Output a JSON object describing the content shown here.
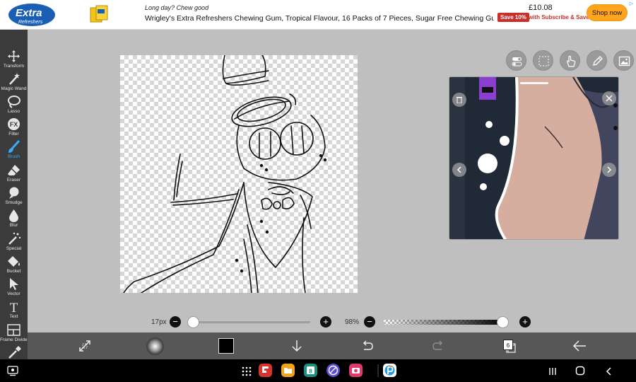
{
  "ad": {
    "brand_logo_text": "Extra Refreshers",
    "tagline": "Long day? Chew good",
    "title": "Wrigley's Extra Refreshers Chewing Gum, Tropical Flavour, 16 Packs of 7 Pieces, Sugar Free Chewing Gum Bulk Pa...",
    "price": "£10.08",
    "save_badge": "Save 10%",
    "subscribe_text": "with Subscribe & Save",
    "cta": "Shop now",
    "info_icon": "info-icon"
  },
  "sidebar": {
    "tools": [
      {
        "label": "Transform",
        "icon": "move-icon"
      },
      {
        "label": "Magic Wand",
        "icon": "magic-wand-icon"
      },
      {
        "label": "Lasso",
        "icon": "lasso-icon"
      },
      {
        "label": "Filter",
        "icon": "fx-icon",
        "icon_text": "FX"
      },
      {
        "label": "Brush",
        "icon": "brush-icon",
        "active": true
      },
      {
        "label": "Eraser",
        "icon": "eraser-icon"
      },
      {
        "label": "Smudge",
        "icon": "smudge-icon"
      },
      {
        "label": "Blur",
        "icon": "drop-icon"
      },
      {
        "label": "Special",
        "icon": "sparkle-wand-icon"
      },
      {
        "label": "Bucket",
        "icon": "bucket-icon"
      },
      {
        "label": "Vector",
        "icon": "cursor-icon"
      },
      {
        "label": "Text",
        "icon": "text-icon",
        "icon_text": "T"
      },
      {
        "label": "Frame Divider",
        "icon": "frame-divider-icon"
      },
      {
        "label": "",
        "icon": "eyedropper-icon"
      }
    ]
  },
  "mode_buttons": [
    "toggle-icon",
    "selection-icon",
    "hand-edit-icon",
    "pen-icon",
    "reference-image-icon"
  ],
  "controls": {
    "brush_size": "17px",
    "brush_size_fraction": 0.0,
    "opacity": "98%",
    "opacity_fraction": 0.98,
    "minus": "−",
    "plus": "+"
  },
  "actionbar": {
    "layers_count": "6",
    "icons": [
      "transform-quick-icon",
      "brush-preview",
      "color-swatch",
      "download-icon",
      "undo-icon",
      "redo-icon",
      "layers-icon",
      "back-arrow-icon"
    ]
  },
  "colors": {
    "accent": "#3fa9f5",
    "sidebar_bg": "#3b3b3b",
    "workspace_bg": "#bfbfbf",
    "actionbar_bg": "#575757",
    "primary_color": "#000000"
  },
  "navbar": {
    "apps": [
      {
        "name": "app-drawer-icon",
        "color": "#000000"
      },
      {
        "name": "flipboard-icon",
        "color": "#d8332c"
      },
      {
        "name": "folder-icon",
        "color": "#f2a31b"
      },
      {
        "name": "calendar-icon",
        "color": "#1d8f7e",
        "text": "8"
      },
      {
        "name": "browser-icon",
        "color": "#5b4fd1"
      },
      {
        "name": "camera-icon",
        "color": "#e0396a"
      },
      {
        "name": "ibispaint-icon",
        "color": "#2a9bd6"
      }
    ]
  }
}
